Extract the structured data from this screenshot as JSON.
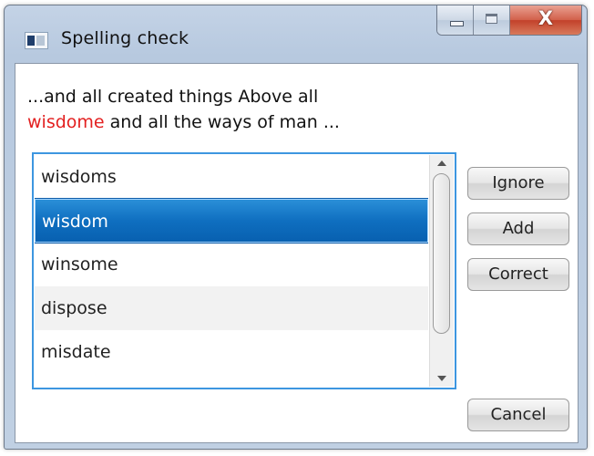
{
  "window": {
    "title": "Spelling check",
    "caption_buttons": {
      "minimize": "minimize-icon",
      "maximize": "maximize-icon",
      "close": "X"
    }
  },
  "sentence": {
    "line1": "...and all created things Above all",
    "misspelled_word": "wisdome",
    "line2_rest": " and all the ways of man ...",
    "misspelled_color": "#e32020"
  },
  "suggestions": {
    "items": [
      "wisdoms",
      "wisdom",
      "winsome",
      "dispose",
      "misdate"
    ],
    "selected_index": 1
  },
  "buttons": {
    "ignore": "Ignore",
    "add": "Add",
    "correct": "Correct",
    "cancel": "Cancel"
  },
  "colors": {
    "selection": "#0f6fc0",
    "focus_border": "#3d96e0",
    "close_button": "#c2412a"
  }
}
